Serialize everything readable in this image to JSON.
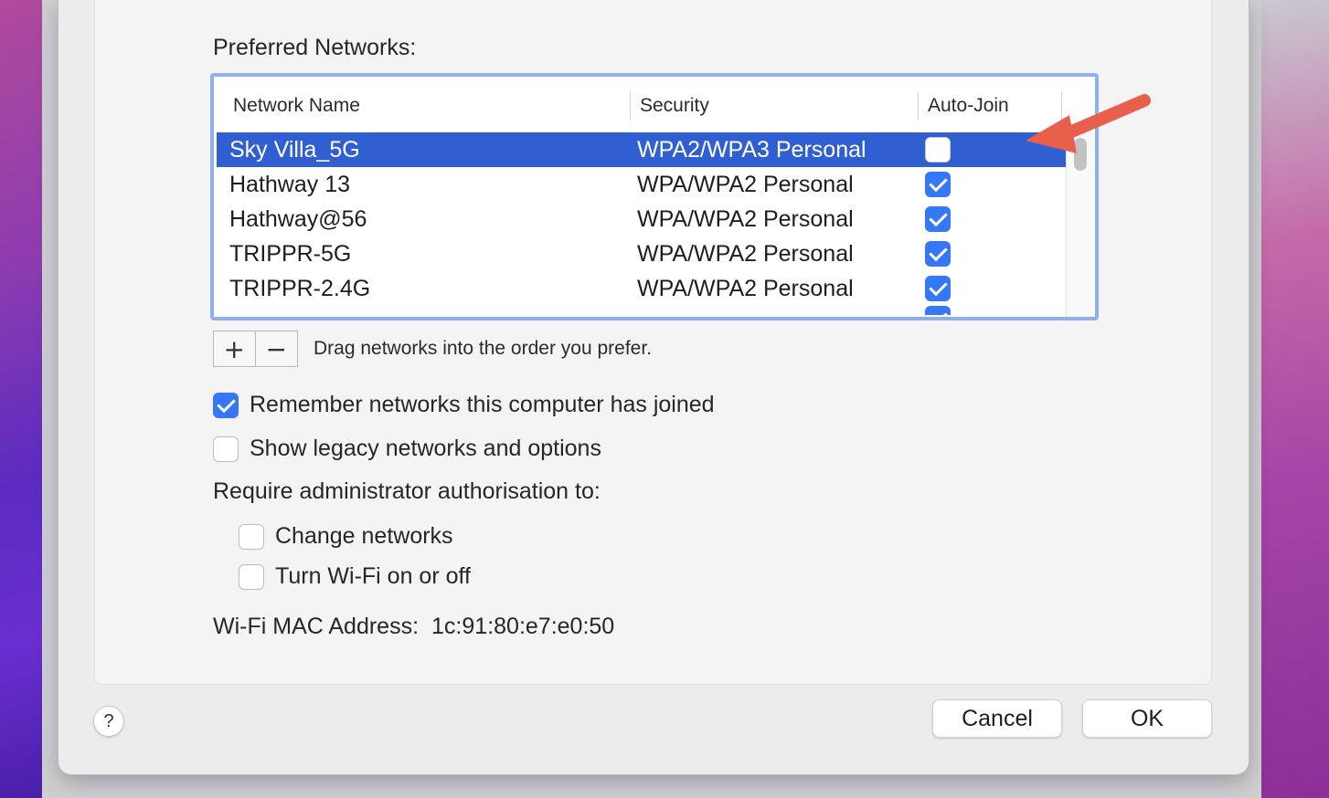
{
  "section_title": "Preferred Networks:",
  "columns": {
    "name": "Network Name",
    "security": "Security",
    "auto_join": "Auto-Join"
  },
  "networks": [
    {
      "name": "Sky Villa_5G",
      "security": "WPA2/WPA3 Personal",
      "auto_join": false,
      "selected": true
    },
    {
      "name": "Hathway 13",
      "security": "WPA/WPA2 Personal",
      "auto_join": true,
      "selected": false
    },
    {
      "name": "Hathway@56",
      "security": "WPA/WPA2 Personal",
      "auto_join": true,
      "selected": false
    },
    {
      "name": "TRIPPR-5G",
      "security": "WPA/WPA2 Personal",
      "auto_join": true,
      "selected": false
    },
    {
      "name": "TRIPPR-2.4G",
      "security": "WPA/WPA2 Personal",
      "auto_join": true,
      "selected": false
    }
  ],
  "list_controls": {
    "add_label": "+",
    "remove_label": "−",
    "hint": "Drag networks into the order you prefer."
  },
  "options": {
    "remember": {
      "label": "Remember networks this computer has joined",
      "checked": true
    },
    "legacy": {
      "label": "Show legacy networks and options",
      "checked": false
    }
  },
  "admin": {
    "title": "Require administrator authorisation to:",
    "change_networks": {
      "label": "Change networks",
      "checked": false
    },
    "toggle_wifi": {
      "label": "Turn Wi-Fi on or off",
      "checked": false
    }
  },
  "mac": {
    "label": "Wi-Fi MAC Address:",
    "value": "1c:91:80:e7:e0:50"
  },
  "buttons": {
    "help": "?",
    "cancel": "Cancel",
    "ok": "OK"
  },
  "colors": {
    "selection": "#2f5fd0",
    "checkbox": "#3478f6",
    "focus_ring": "#8fb0ec",
    "annotation_arrow": "#e8604c"
  },
  "icons": {
    "annotation": "red-arrow-icon"
  }
}
